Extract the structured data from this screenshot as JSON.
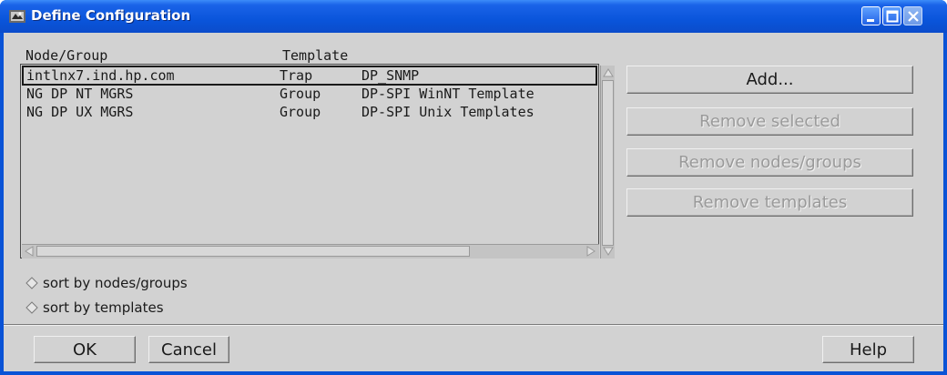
{
  "window": {
    "title": "Define Configuration"
  },
  "list": {
    "headers": {
      "node_group": "Node/Group",
      "template": "Template"
    },
    "rows": [
      {
        "node": "intlnx7.ind.hp.com",
        "type": "Trap",
        "template": "DP_SNMP",
        "selected": true
      },
      {
        "node": "NG DP NT MGRS",
        "type": "Group",
        "template": "DP-SPI WinNT Template",
        "selected": false
      },
      {
        "node": "NG DP UX MGRS",
        "type": "Group",
        "template": "DP-SPI Unix Templates",
        "selected": false
      }
    ]
  },
  "actions": {
    "add": "Add...",
    "remove_selected": "Remove selected",
    "remove_nodes_groups": "Remove nodes/groups",
    "remove_templates": "Remove templates"
  },
  "sort": {
    "by_nodes": "sort by nodes/groups",
    "by_templates": "sort by templates"
  },
  "footer": {
    "ok": "OK",
    "cancel": "Cancel",
    "help": "Help"
  },
  "colors": {
    "titlebar": "#0A55DB",
    "client_bg": "#D2D2D2",
    "disabled_text": "#9A9A9A"
  }
}
